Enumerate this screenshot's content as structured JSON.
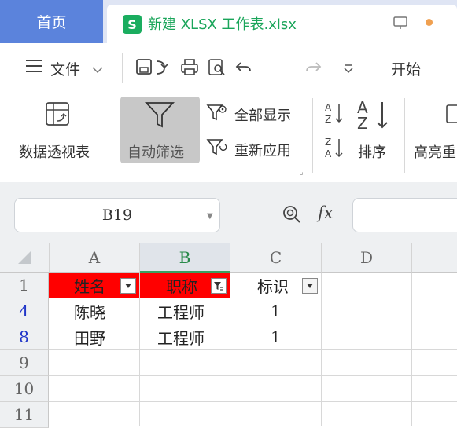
{
  "tabs": {
    "home": "首页",
    "document": "新建 XLSX 工作表.xlsx",
    "doc_icon_letter": "S"
  },
  "menu": {
    "file": "文件",
    "start": "开始"
  },
  "ribbon": {
    "pivot_table": "数据透视表",
    "auto_filter": "自动筛选",
    "show_all": "全部显示",
    "reapply": "重新应用",
    "sort": "排序",
    "highlight": "高亮重"
  },
  "formula_bar": {
    "name_box": "B19",
    "fx": "fx"
  },
  "columns": [
    "A",
    "B",
    "C",
    "D"
  ],
  "rows": [
    {
      "num": "1",
      "cells": [
        "姓名",
        "职称",
        "标识"
      ]
    },
    {
      "num": "4",
      "cells": [
        "陈晓",
        "工程师",
        "1"
      ]
    },
    {
      "num": "8",
      "cells": [
        "田野",
        "工程师",
        "1"
      ]
    },
    {
      "num": "9",
      "cells": [
        "",
        "",
        ""
      ]
    },
    {
      "num": "10",
      "cells": [
        "",
        "",
        ""
      ]
    },
    {
      "num": "11",
      "cells": [
        "",
        "",
        ""
      ]
    }
  ],
  "colors": {
    "accent_blue": "#5b83dc",
    "wps_green": "#1aad5f",
    "header_red": "#ff0000",
    "filtered_row_blue": "#2035c8"
  }
}
